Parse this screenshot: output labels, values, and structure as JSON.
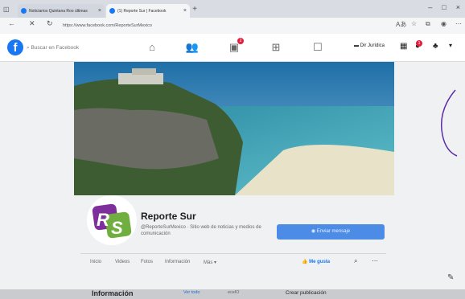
{
  "browser": {
    "tabs": [
      {
        "label": "Noticiarios Quintana Roo últimas",
        "close": "×"
      },
      {
        "label": "(1) Reporte Sur | Facebook",
        "close": "×"
      }
    ],
    "new_tab": "+",
    "window_controls": [
      "–",
      "□",
      "×"
    ],
    "address": "https://www.facebook.com/ReporteSurMexico"
  },
  "fb_header": {
    "logo": "f",
    "search_placeholder": "Buscar en Facebook",
    "nav_badge": "2",
    "profile_name": "Dir Jurídica",
    "header_badge": "1"
  },
  "page": {
    "name": "Reporte Sur",
    "description": "@ReporteSurMexico · Sitio web de noticias y medios de comunicación",
    "message_button": "Enviar mensaje",
    "tabs": [
      "Inicio",
      "Videos",
      "Fotos",
      "Información",
      "Más ▾"
    ],
    "like_button": "Me gusta",
    "info_heading": "Información",
    "see_all": "Ver todo",
    "info_sub": "ecelO",
    "create_post": "Crear publicación"
  },
  "colors": {
    "fb_blue": "#1877f2",
    "button_blue": "#4c8ce6"
  }
}
